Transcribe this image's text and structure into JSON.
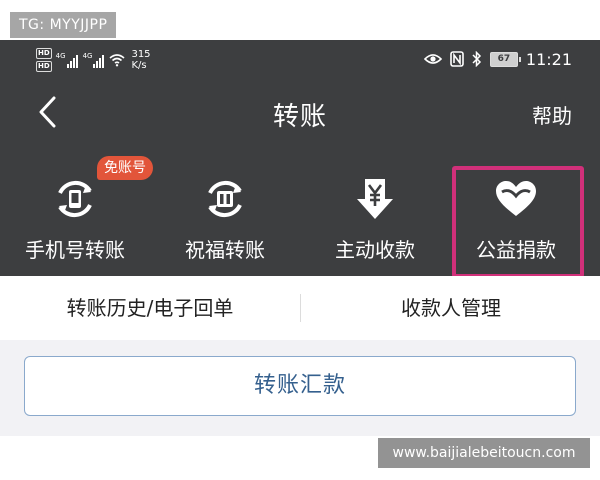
{
  "watermarks": {
    "top": "TG: MYYJJPP",
    "bottom": "www.baijialebeitoucn.com"
  },
  "status_bar": {
    "hd1": "HD",
    "hd2": "HD",
    "net1": "4G",
    "net2": "4G",
    "speed_value": "315",
    "speed_unit": "K/s",
    "battery": "67",
    "time": "11:21"
  },
  "nav": {
    "title": "转账",
    "help": "帮助"
  },
  "actions": {
    "phone_transfer": {
      "label": "手机号转账",
      "badge": "免账号",
      "icon": "phone-transfer-icon"
    },
    "blessing_transfer": {
      "label": "祝福转账",
      "icon": "gift-transfer-icon"
    },
    "active_receive": {
      "label": "主动收款",
      "icon": "yen-receive-icon"
    },
    "charity": {
      "label": "公益捐款",
      "icon": "heart-icon"
    }
  },
  "tabs": {
    "history": "转账历史/电子回单",
    "payee": "收款人管理"
  },
  "transfer_button": "转账汇款",
  "colors": {
    "header_bg": "#3d3e40",
    "badge": "#e2553a",
    "highlight": "#d1307a",
    "button_text": "#35608e",
    "button_border": "#8aa9cc"
  }
}
